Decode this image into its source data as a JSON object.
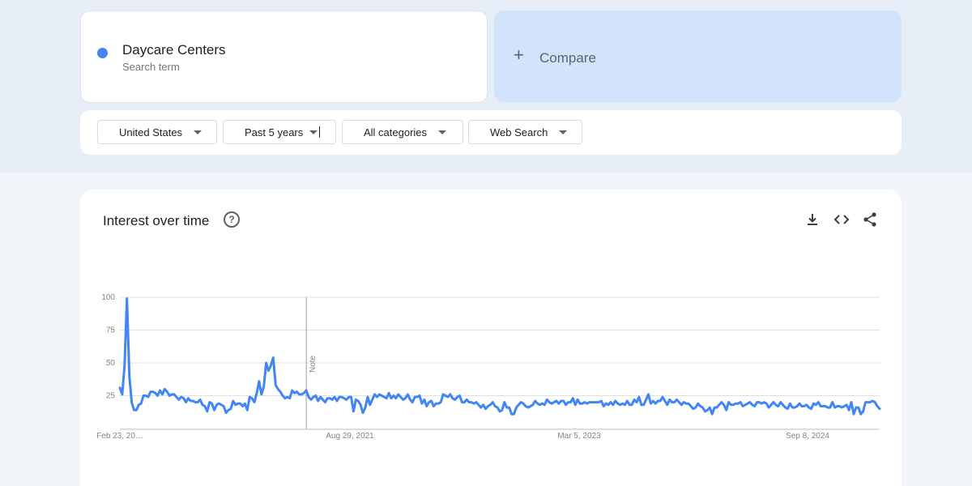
{
  "search_term": {
    "name": "Daycare Centers",
    "subtitle": "Search term",
    "dot_color": "#4285f4"
  },
  "compare": {
    "plus": "+",
    "label": "Compare"
  },
  "filters": [
    {
      "label": "United States"
    },
    {
      "label": "Past 5 years"
    },
    {
      "label": "All categories"
    },
    {
      "label": "Web Search"
    }
  ],
  "chart": {
    "title": "Interest over time",
    "help_icon": "?",
    "toolbar_icons": [
      "download-icon",
      "embed-icon",
      "share-icon"
    ]
  },
  "chart_data": {
    "type": "line",
    "series_color": "#4285f4",
    "ylim": [
      0,
      100
    ],
    "y_ticks": [
      "100",
      "75",
      "50",
      "25"
    ],
    "x_labels": [
      "Feb 23, 20…",
      "Aug 29, 2021",
      "Mar 5, 2023",
      "Sep 8, 2024"
    ],
    "note_marker": {
      "label": "Note",
      "at_week": 79
    },
    "values": [
      31,
      26,
      48,
      99,
      40,
      20,
      14,
      14,
      18,
      19,
      25,
      25,
      24,
      28,
      28,
      27,
      25,
      29,
      26,
      30,
      28,
      25,
      26,
      26,
      24,
      22,
      24,
      23,
      20,
      23,
      21,
      21,
      20,
      20,
      22,
      18,
      17,
      13,
      20,
      19,
      14,
      18,
      19,
      18,
      17,
      12,
      14,
      15,
      21,
      18,
      19,
      19,
      17,
      19,
      14,
      24,
      23,
      20,
      27,
      36,
      26,
      32,
      50,
      44,
      48,
      54,
      33,
      30,
      28,
      25,
      23,
      24,
      23,
      29,
      27,
      28,
      26,
      26,
      27,
      29,
      24,
      22,
      24,
      25,
      21,
      24,
      22,
      20,
      23,
      23,
      22,
      24,
      21,
      24,
      24,
      23,
      22,
      24,
      24,
      13,
      22,
      21,
      18,
      12,
      16,
      24,
      18,
      22,
      26,
      24,
      26,
      25,
      24,
      23,
      27,
      23,
      25,
      23,
      26,
      24,
      22,
      23,
      26,
      22,
      20,
      24,
      24,
      25,
      19,
      22,
      17,
      20,
      21,
      17,
      19,
      19,
      20,
      26,
      25,
      24,
      26,
      23,
      22,
      24,
      25,
      20,
      20,
      22,
      20,
      20,
      19,
      20,
      18,
      16,
      18,
      15,
      17,
      18,
      20,
      17,
      16,
      13,
      14,
      20,
      16,
      16,
      11,
      11,
      16,
      18,
      20,
      19,
      17,
      16,
      17,
      18,
      21,
      19,
      18,
      19,
      18,
      22,
      20,
      19,
      20,
      21,
      19,
      21,
      21,
      18,
      20,
      20,
      23,
      18,
      22,
      19,
      19,
      20,
      19,
      20,
      20,
      20,
      20,
      20,
      21,
      17,
      19,
      18,
      20,
      18,
      21,
      19,
      18,
      19,
      18,
      21,
      18,
      18,
      22,
      20,
      24,
      18,
      18,
      22,
      26,
      19,
      21,
      19,
      21,
      21,
      24,
      21,
      18,
      22,
      20,
      20,
      22,
      20,
      18,
      20,
      19,
      19,
      17,
      15,
      16,
      19,
      17,
      16,
      13,
      14,
      16,
      11,
      16,
      16,
      18,
      20,
      18,
      14,
      20,
      18,
      18,
      19,
      19,
      20,
      17,
      18,
      19,
      20,
      18,
      17,
      20,
      20,
      19,
      20,
      19,
      16,
      18,
      20,
      18,
      17,
      20,
      18,
      16,
      15,
      19,
      16,
      16,
      17,
      19,
      17,
      17,
      18,
      16,
      15,
      19,
      18,
      20,
      17,
      17,
      17,
      16,
      16,
      20,
      16,
      17,
      17,
      16,
      17,
      18,
      14,
      20,
      11,
      16,
      16,
      11,
      13,
      20,
      20,
      20,
      21,
      20,
      17,
      15
    ]
  }
}
